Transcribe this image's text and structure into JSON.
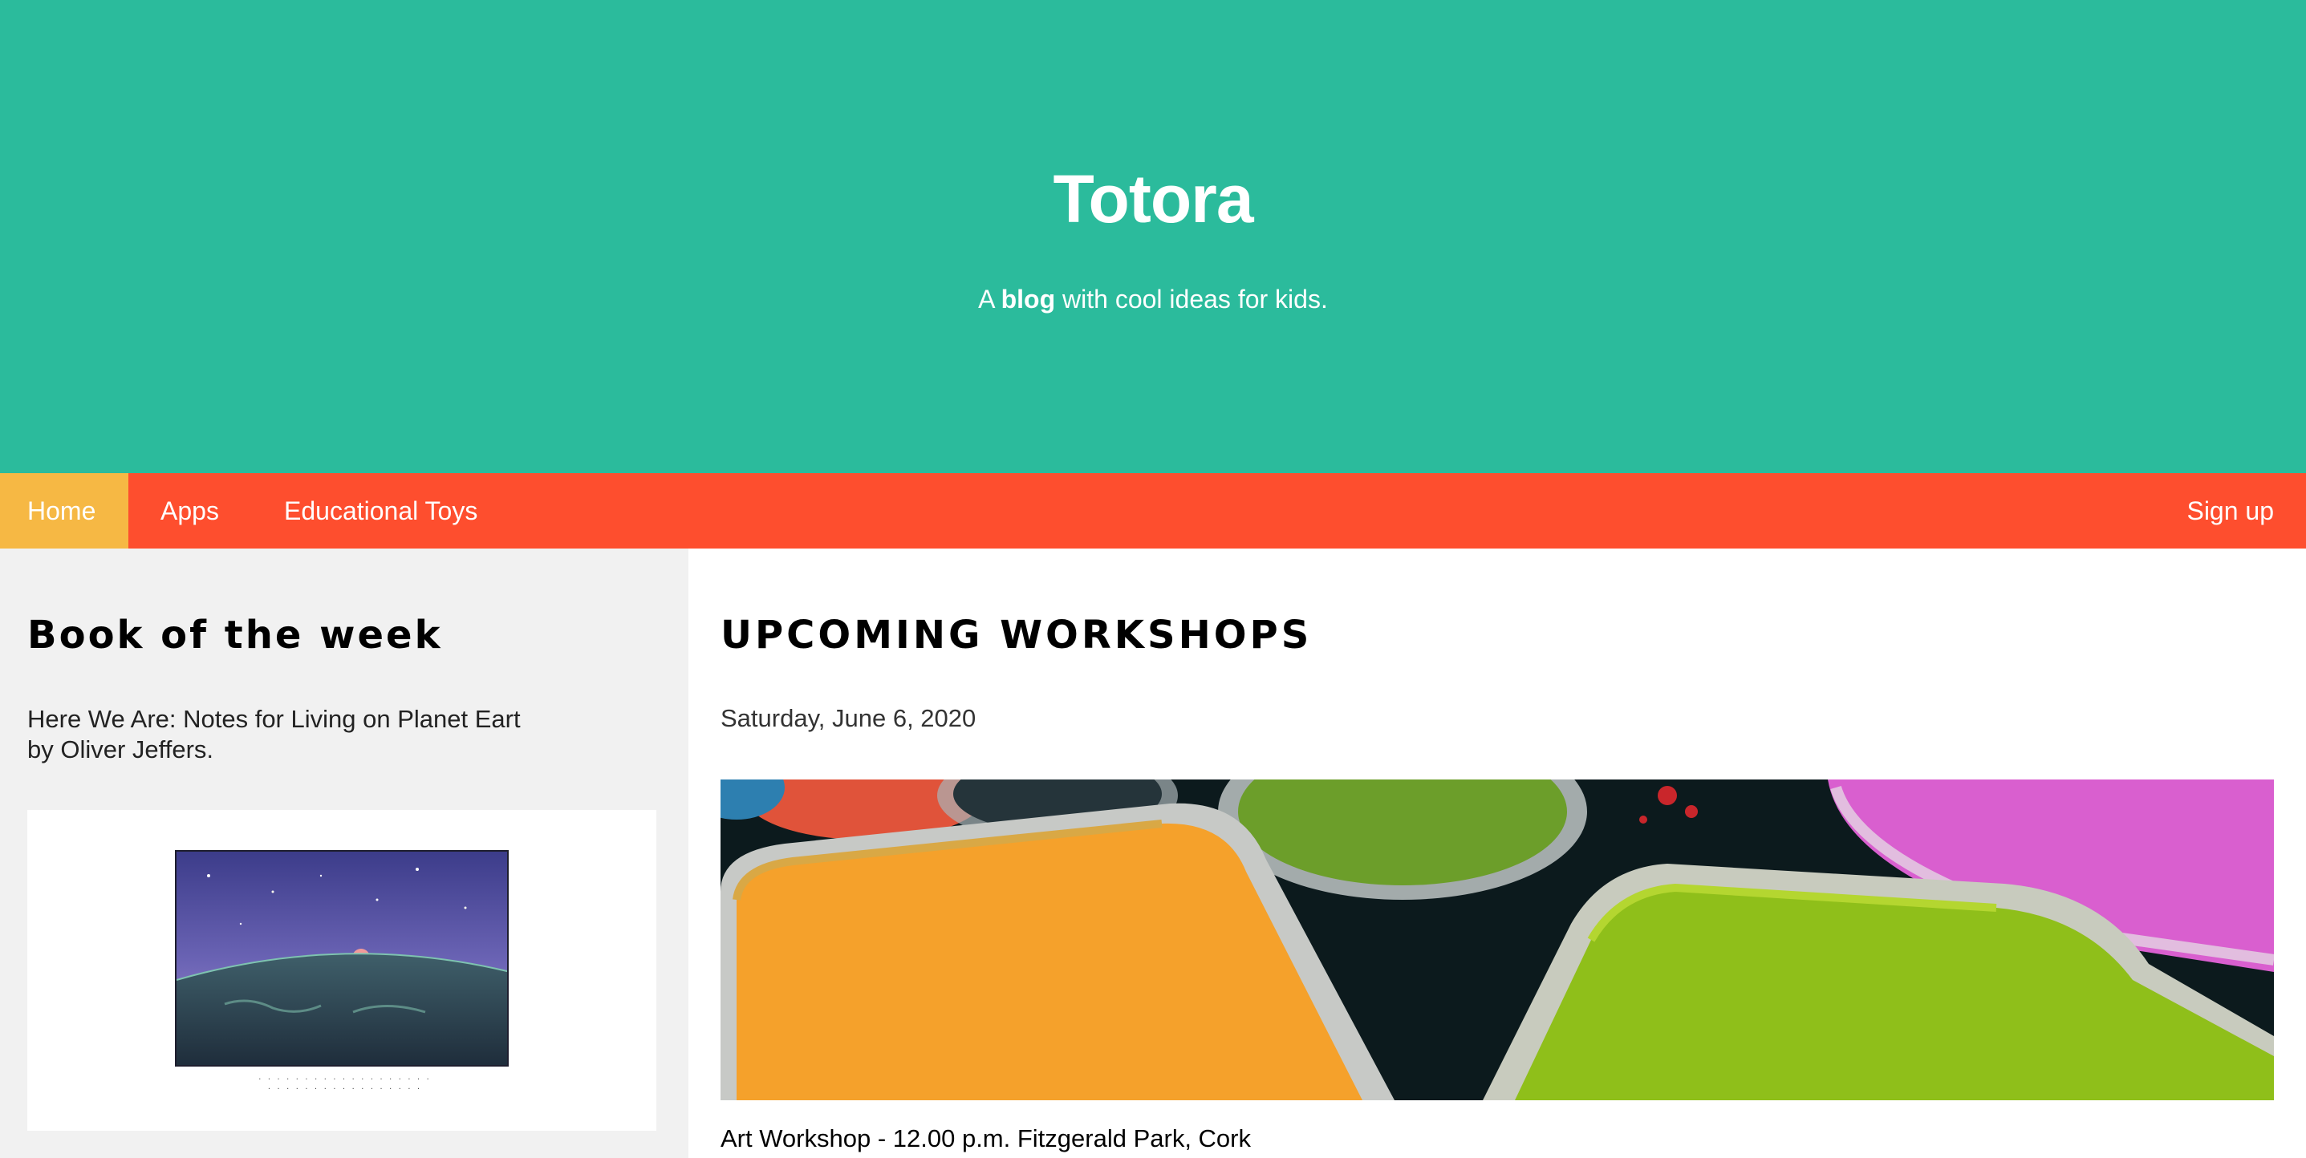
{
  "hero": {
    "title": "Totora",
    "tagline_prefix": "A ",
    "tagline_bold": "blog",
    "tagline_suffix": " with cool ideas for kids."
  },
  "nav": {
    "home": "Home",
    "apps": "Apps",
    "toys": "Educational Toys",
    "signup": "Sign up"
  },
  "sidebar": {
    "heading": "Book of the week",
    "book_title": "Here We Are: Notes for Living on Planet Eart",
    "book_author": "by Oliver Jeffers."
  },
  "main": {
    "heading": "UPCOMING WORKSHOPS",
    "event_date": "Saturday, June 6, 2020",
    "event_title": "Art Workshop - 12.00 p.m. Fitzgerald Park, Cork"
  },
  "colors": {
    "hero_bg": "#2bbb9c",
    "nav_bg": "#fe4e2e",
    "nav_active": "#f6b844",
    "sidebar_bg": "#f1f1f1"
  }
}
